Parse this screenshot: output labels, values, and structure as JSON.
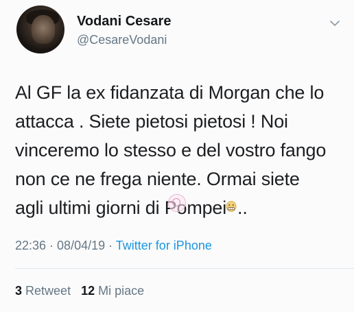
{
  "user": {
    "display_name": "Vodani Cesare",
    "handle": "@CesareVodani",
    "avatar_icon": "profile-photo"
  },
  "tweet": {
    "lines": [
      "Al GF la ex fidanzata di Morgan che lo",
      "attacca . Siete pietosi pietosi ! Noi",
      "vinceremo lo stesso e del vostro fango",
      "non ce ne frega niente. Ormai siete",
      "agli ultimi giorni di Pompei"
    ],
    "trailing": "..",
    "emoji_icon": "grimacing-face-emoji"
  },
  "meta": {
    "time": "22:36",
    "separator": " · ",
    "date": "08/04/19",
    "source": "Twitter for iPhone"
  },
  "stats": {
    "retweet_count": "3",
    "retweet_label": "Retweet",
    "likes_count": "12",
    "likes_label": "Mi piace"
  },
  "colors": {
    "name": "#14171a",
    "secondary": "#657786",
    "link": "#1b95e0",
    "divider": "#e1e8ed"
  },
  "icons": {
    "chevron": "chevron-down-icon",
    "watermark": "watermark-badge"
  }
}
